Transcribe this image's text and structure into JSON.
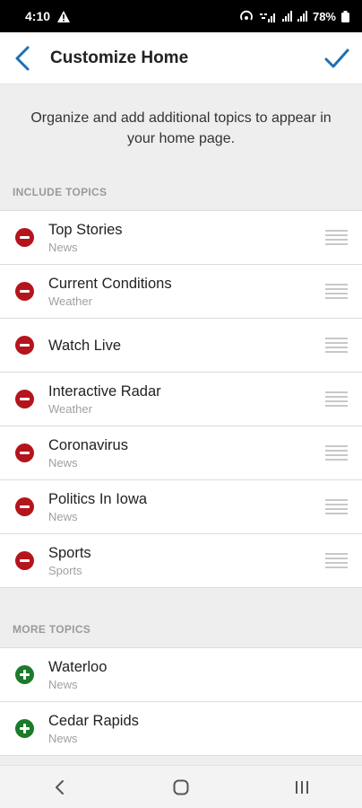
{
  "status_bar": {
    "time": "4:10",
    "battery": "78%",
    "icons": [
      "alert-icon",
      "hotspot-icon",
      "wifi-icon",
      "signal-icon",
      "signal-icon",
      "battery-icon"
    ]
  },
  "header": {
    "title": "Customize Home",
    "back_icon": "back-chevron-icon",
    "confirm_icon": "checkmark-icon",
    "accent_color": "#1e6fb3"
  },
  "intro_text": "Organize and add additional topics to appear in your home page.",
  "include_section": {
    "title": "INCLUDE TOPICS",
    "action_color": "#b5141c",
    "items": [
      {
        "title": "Top Stories",
        "subtitle": "News"
      },
      {
        "title": "Current Conditions",
        "subtitle": "Weather"
      },
      {
        "title": "Watch Live",
        "subtitle": ""
      },
      {
        "title": "Interactive Radar",
        "subtitle": "Weather"
      },
      {
        "title": "Coronavirus",
        "subtitle": "News"
      },
      {
        "title": "Politics In Iowa",
        "subtitle": "News"
      },
      {
        "title": "Sports",
        "subtitle": "Sports"
      }
    ]
  },
  "more_section": {
    "title": "MORE TOPICS",
    "action_color": "#1d7a2a",
    "items": [
      {
        "title": "Waterloo",
        "subtitle": "News"
      },
      {
        "title": "Cedar Rapids",
        "subtitle": "News"
      }
    ]
  },
  "nav_bar": {
    "icons": [
      "nav-back-icon",
      "home-icon",
      "recent-apps-icon"
    ]
  }
}
